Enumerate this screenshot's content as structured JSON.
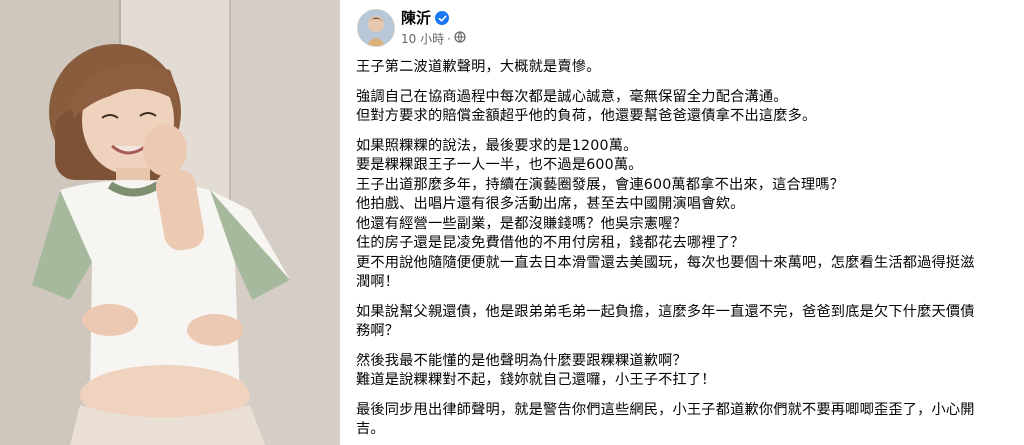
{
  "post": {
    "author": "陳沂",
    "time": "10 小時",
    "separator": "·",
    "icons": {
      "verified": "verified-badge-icon",
      "audience": "globe-icon"
    },
    "paragraphs": [
      [
        "王子第二波道歉聲明，大概就是賣慘。"
      ],
      [
        "強調自己在協商過程中每次都是誠心誠意，毫無保留全力配合溝通。",
        "但對方要求的賠償金額超乎他的負荷，他還要幫爸爸還債拿不出這麼多。"
      ],
      [
        "如果照粿粿的說法，最後要求的是1200萬。",
        "要是粿粿跟王子一人一半，也不過是600萬。",
        "王子出道那麼多年，持續在演藝圈發展，會連600萬都拿不出來，這合理嗎？",
        "他拍戲、出唱片還有很多活動出席，甚至去中國開演唱會欸。",
        "他還有經營一些副業，是都沒賺錢嗎？他吳宗憲喔？",
        "住的房子還是昆凌免費借他的不用付房租，錢都花去哪裡了？",
        "更不用說他隨隨便便就一直去日本滑雪還去美國玩，每次也要個十來萬吧，怎麼看生活都過得挺滋",
        "潤啊！"
      ],
      [
        "如果說幫父親還債，他是跟弟弟毛弟一起負擔，這麼多年一直還不完，爸爸到底是欠下什麼天價債",
        "務啊？"
      ],
      [
        "然後我最不能懂的是他聲明為什麼要跟粿粿道歉啊？",
        "難道是說粿粿對不起，錢妳就自己還囉，小王子不扛了！"
      ],
      [
        "最後同步甩出律師聲明，就是警告你們這些網民，小王子都道歉你們就不要再唧唧歪歪了，小心開",
        "吉。"
      ]
    ]
  },
  "colors": {
    "accent": "#1877f2",
    "text": "#050505",
    "meta": "#65676b"
  }
}
